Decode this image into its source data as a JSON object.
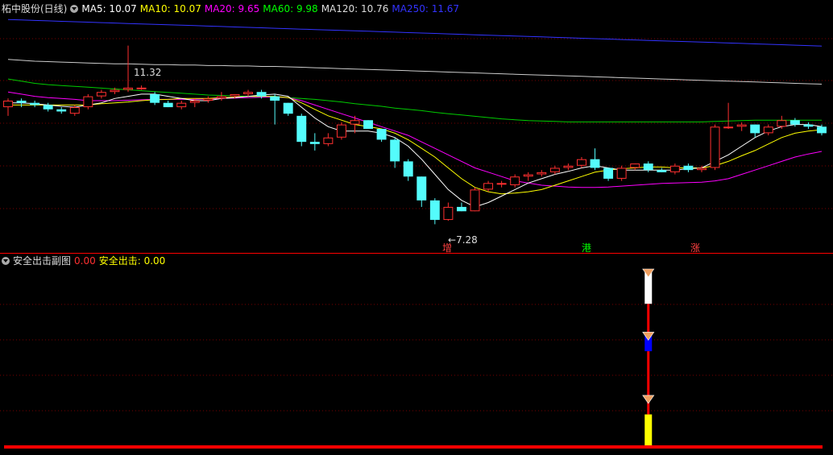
{
  "main_header": {
    "title": "柘中股份(日线)",
    "indicators": [
      {
        "label": "MA5: 10.07",
        "color": "#ffffff"
      },
      {
        "label": "MA10: 10.07",
        "color": "#ffff00"
      },
      {
        "label": "MA20: 9.65",
        "color": "#ff00ff"
      },
      {
        "label": "MA60: 9.98",
        "color": "#00ff00"
      },
      {
        "label": "MA120: 10.76",
        "color": "#dddddd"
      },
      {
        "label": "MA250: 11.67",
        "color": "#3333ff"
      }
    ]
  },
  "sub_header": {
    "title": "安全出击副图",
    "value1": "0.00",
    "label2": "安全出击: 0.00"
  },
  "annotations": {
    "high_label": "11.32",
    "low_label": "7.28",
    "tags": [
      {
        "text": "增",
        "color": "#ff4040"
      },
      {
        "text": "港",
        "color": "#00ff00"
      },
      {
        "text": "涨",
        "color": "#ff4040"
      }
    ]
  },
  "colors": {
    "up": "#ff3030",
    "down": "#54fcfc",
    "grid": "#7a0000",
    "divider": "#ff0000"
  },
  "chart_data": {
    "type": "candlestick",
    "price_range": [
      6.8,
      12.0
    ],
    "candles": [
      [
        9.9,
        10.1,
        9.7,
        10.05
      ],
      [
        10.05,
        10.1,
        9.9,
        10.0
      ],
      [
        10.0,
        10.05,
        9.9,
        9.95
      ],
      [
        9.95,
        10.0,
        9.8,
        9.85
      ],
      [
        9.85,
        9.9,
        9.75,
        9.8
      ],
      [
        9.75,
        9.95,
        9.7,
        9.9
      ],
      [
        9.9,
        10.2,
        9.85,
        10.15
      ],
      [
        10.15,
        10.3,
        10.1,
        10.25
      ],
      [
        10.25,
        10.35,
        10.2,
        10.3
      ],
      [
        10.3,
        11.32,
        10.25,
        10.35
      ],
      [
        10.35,
        10.4,
        10.3,
        10.35
      ],
      [
        10.2,
        10.25,
        9.95,
        10.0
      ],
      [
        10.0,
        10.05,
        9.9,
        9.9
      ],
      [
        9.9,
        10.05,
        9.85,
        10.0
      ],
      [
        10.0,
        10.1,
        9.9,
        10.05
      ],
      [
        10.05,
        10.15,
        10.0,
        10.1
      ],
      [
        10.1,
        10.25,
        10.05,
        10.15
      ],
      [
        10.15,
        10.2,
        10.1,
        10.2
      ],
      [
        10.2,
        10.3,
        10.15,
        10.25
      ],
      [
        10.25,
        10.3,
        10.1,
        10.15
      ],
      [
        10.15,
        10.2,
        9.5,
        10.05
      ],
      [
        10.0,
        10.0,
        9.7,
        9.75
      ],
      [
        9.7,
        9.75,
        9.0,
        9.1
      ],
      [
        9.1,
        9.3,
        8.9,
        9.05
      ],
      [
        9.05,
        9.3,
        9.0,
        9.2
      ],
      [
        9.2,
        9.55,
        9.15,
        9.5
      ],
      [
        9.5,
        9.7,
        9.3,
        9.6
      ],
      [
        9.6,
        9.6,
        9.4,
        9.4
      ],
      [
        9.4,
        9.4,
        9.1,
        9.15
      ],
      [
        9.15,
        9.2,
        8.5,
        8.65
      ],
      [
        8.65,
        8.7,
        8.2,
        8.3
      ],
      [
        8.3,
        8.3,
        7.6,
        7.75
      ],
      [
        7.75,
        7.8,
        7.2,
        7.3
      ],
      [
        7.3,
        7.7,
        7.28,
        7.6
      ],
      [
        7.6,
        7.7,
        7.5,
        7.5
      ],
      [
        7.5,
        8.05,
        7.5,
        8.0
      ],
      [
        8.0,
        8.2,
        7.95,
        8.15
      ],
      [
        8.15,
        8.2,
        8.05,
        8.15
      ],
      [
        8.1,
        8.35,
        8.05,
        8.3
      ],
      [
        8.3,
        8.4,
        8.2,
        8.35
      ],
      [
        8.35,
        8.45,
        8.3,
        8.4
      ],
      [
        8.4,
        8.55,
        8.35,
        8.5
      ],
      [
        8.5,
        8.6,
        8.45,
        8.55
      ],
      [
        8.55,
        8.75,
        8.5,
        8.7
      ],
      [
        8.7,
        8.95,
        8.45,
        8.5
      ],
      [
        8.5,
        8.5,
        8.2,
        8.25
      ],
      [
        8.25,
        8.55,
        8.2,
        8.5
      ],
      [
        8.5,
        8.6,
        8.45,
        8.6
      ],
      [
        8.6,
        8.65,
        8.4,
        8.45
      ],
      [
        8.45,
        8.5,
        8.4,
        8.4
      ],
      [
        8.4,
        8.6,
        8.35,
        8.55
      ],
      [
        8.55,
        8.6,
        8.4,
        8.45
      ],
      [
        8.45,
        8.55,
        8.4,
        8.5
      ],
      [
        8.5,
        9.5,
        8.45,
        9.45
      ],
      [
        9.45,
        10.0,
        9.4,
        9.45
      ],
      [
        9.45,
        9.55,
        9.35,
        9.5
      ],
      [
        9.5,
        9.5,
        9.2,
        9.3
      ],
      [
        9.3,
        9.5,
        9.25,
        9.45
      ],
      [
        9.45,
        9.7,
        9.4,
        9.6
      ],
      [
        9.6,
        9.65,
        9.45,
        9.5
      ],
      [
        9.5,
        9.55,
        9.4,
        9.45
      ],
      [
        9.45,
        9.5,
        9.25,
        9.3
      ]
    ],
    "ma5": [
      10.0,
      10.0,
      9.98,
      9.95,
      9.92,
      9.9,
      9.95,
      10.0,
      10.1,
      10.15,
      10.2,
      10.2,
      10.15,
      10.1,
      10.05,
      10.05,
      10.1,
      10.12,
      10.15,
      10.18,
      10.2,
      10.15,
      9.9,
      9.65,
      9.45,
      9.35,
      9.35,
      9.35,
      9.3,
      9.2,
      9.0,
      8.7,
      8.35,
      8.0,
      7.75,
      7.6,
      7.7,
      7.85,
      8.0,
      8.15,
      8.25,
      8.35,
      8.42,
      8.5,
      8.55,
      8.5,
      8.45,
      8.45,
      8.45,
      8.45,
      8.45,
      8.48,
      8.5,
      8.65,
      8.8,
      9.0,
      9.2,
      9.35,
      9.45,
      9.5,
      9.5,
      9.45
    ],
    "ma10": [
      9.95,
      9.95,
      9.95,
      9.95,
      9.95,
      9.95,
      9.95,
      9.98,
      10.0,
      10.02,
      10.05,
      10.07,
      10.08,
      10.1,
      10.1,
      10.1,
      10.12,
      10.13,
      10.15,
      10.15,
      10.15,
      10.12,
      10.0,
      9.85,
      9.7,
      9.6,
      9.5,
      9.45,
      9.4,
      9.3,
      9.15,
      8.95,
      8.75,
      8.5,
      8.25,
      8.05,
      7.95,
      7.9,
      7.92,
      7.95,
      8.0,
      8.1,
      8.2,
      8.3,
      8.4,
      8.45,
      8.48,
      8.5,
      8.52,
      8.52,
      8.5,
      8.5,
      8.5,
      8.55,
      8.65,
      8.78,
      8.9,
      9.05,
      9.2,
      9.3,
      9.35,
      9.38
    ],
    "ma20": [
      10.25,
      10.2,
      10.15,
      10.12,
      10.1,
      10.08,
      10.05,
      10.05,
      10.05,
      10.06,
      10.07,
      10.08,
      10.08,
      10.08,
      10.08,
      10.09,
      10.1,
      10.11,
      10.12,
      10.13,
      10.14,
      10.12,
      10.05,
      9.95,
      9.85,
      9.75,
      9.65,
      9.55,
      9.45,
      9.35,
      9.25,
      9.1,
      8.95,
      8.8,
      8.65,
      8.5,
      8.4,
      8.3,
      8.2,
      8.15,
      8.1,
      8.08,
      8.06,
      8.05,
      8.05,
      8.06,
      8.08,
      8.1,
      8.12,
      8.14,
      8.15,
      8.16,
      8.17,
      8.2,
      8.25,
      8.35,
      8.45,
      8.55,
      8.65,
      8.75,
      8.82,
      8.88
    ],
    "ma60": [
      10.55,
      10.5,
      10.45,
      10.42,
      10.4,
      10.38,
      10.36,
      10.34,
      10.32,
      10.3,
      10.28,
      10.26,
      10.24,
      10.22,
      10.2,
      10.18,
      10.17,
      10.16,
      10.15,
      10.14,
      10.13,
      10.12,
      10.1,
      10.08,
      10.05,
      10.02,
      9.98,
      9.95,
      9.92,
      9.88,
      9.85,
      9.82,
      9.78,
      9.75,
      9.72,
      9.69,
      9.66,
      9.63,
      9.61,
      9.59,
      9.58,
      9.57,
      9.56,
      9.56,
      9.56,
      9.56,
      9.56,
      9.56,
      9.56,
      9.56,
      9.56,
      9.56,
      9.56,
      9.57,
      9.58,
      9.59,
      9.6,
      9.6,
      9.6,
      9.6,
      9.6,
      9.6
    ],
    "ma120": [
      11.0,
      10.98,
      10.96,
      10.95,
      10.94,
      10.93,
      10.92,
      10.91,
      10.9,
      10.9,
      10.89,
      10.88,
      10.88,
      10.87,
      10.87,
      10.86,
      10.86,
      10.85,
      10.85,
      10.84,
      10.84,
      10.83,
      10.82,
      10.81,
      10.8,
      10.79,
      10.78,
      10.77,
      10.76,
      10.75,
      10.74,
      10.73,
      10.72,
      10.71,
      10.7,
      10.69,
      10.68,
      10.67,
      10.66,
      10.65,
      10.64,
      10.63,
      10.62,
      10.61,
      10.6,
      10.59,
      10.58,
      10.57,
      10.56,
      10.55,
      10.54,
      10.53,
      10.52,
      10.51,
      10.5,
      10.49,
      10.48,
      10.47,
      10.46,
      10.45,
      10.44,
      10.43
    ],
    "ma250": [
      11.92,
      11.91,
      11.9,
      11.89,
      11.88,
      11.87,
      11.86,
      11.85,
      11.84,
      11.83,
      11.82,
      11.81,
      11.8,
      11.79,
      11.78,
      11.77,
      11.76,
      11.75,
      11.74,
      11.73,
      11.72,
      11.71,
      11.7,
      11.69,
      11.68,
      11.67,
      11.66,
      11.65,
      11.64,
      11.63,
      11.62,
      11.61,
      11.6,
      11.59,
      11.58,
      11.57,
      11.56,
      11.55,
      11.54,
      11.53,
      11.52,
      11.51,
      11.5,
      11.49,
      11.48,
      11.47,
      11.46,
      11.45,
      11.44,
      11.43,
      11.42,
      11.41,
      11.4,
      11.39,
      11.38,
      11.37,
      11.36,
      11.35,
      11.34,
      11.33,
      11.32,
      11.31
    ],
    "subchart": {
      "signal_index": 48,
      "segments": [
        {
          "from": 0.0,
          "to": 0.19,
          "color": "#ffff00"
        },
        {
          "from": 0.19,
          "to": 0.28,
          "color": "#ff0000"
        },
        {
          "from": 0.28,
          "to": 0.36,
          "color": "#ff0000"
        },
        {
          "from": 0.36,
          "to": 0.55,
          "color": "#ff0000"
        },
        {
          "from": 0.55,
          "to": 0.64,
          "color": "#0000ff"
        },
        {
          "from": 0.64,
          "to": 0.82,
          "color": "#ff0000"
        },
        {
          "from": 0.82,
          "to": 1.0,
          "color": "#ffffff"
        }
      ],
      "markers": [
        0.28,
        0.64,
        1.0
      ]
    }
  }
}
